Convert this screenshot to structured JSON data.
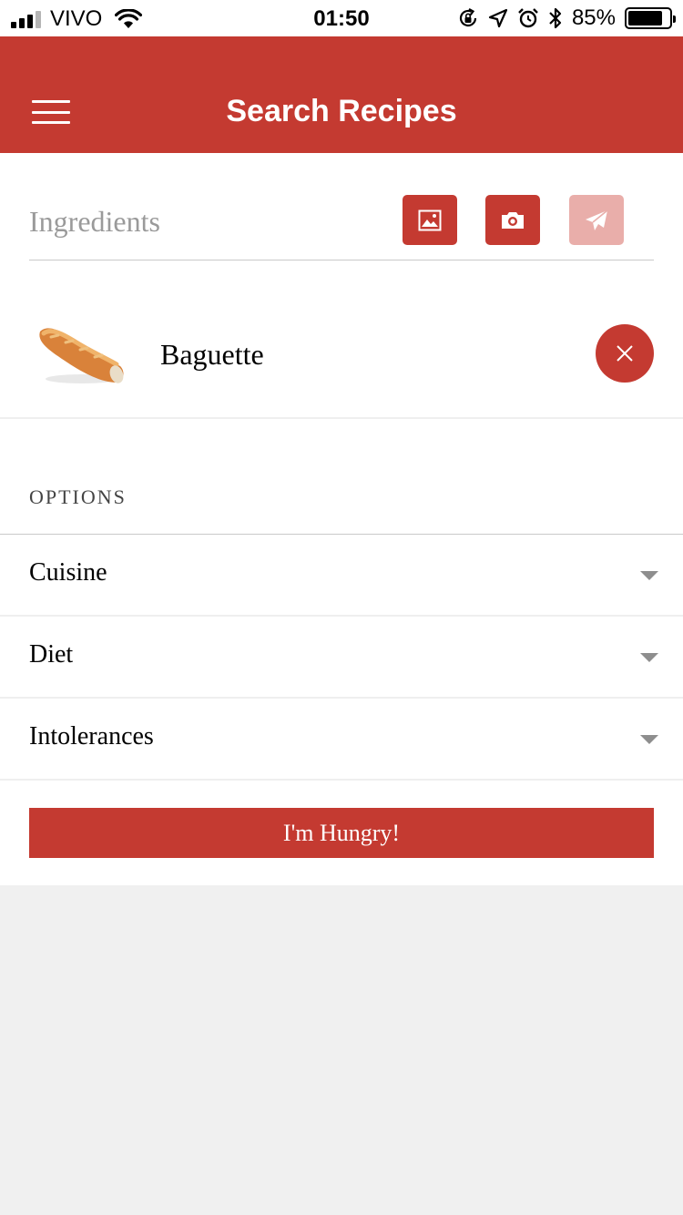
{
  "status_bar": {
    "carrier": "VIVO",
    "time": "01:50",
    "battery_percent": "85%",
    "battery_level": 0.85
  },
  "header": {
    "title": "Search Recipes",
    "background_color": "#c43a31",
    "menu_icon": "hamburger-menu-icon"
  },
  "ingredients": {
    "placeholder": "Ingredients",
    "value": "",
    "buttons": [
      {
        "icon": "image-gallery-icon",
        "enabled": true
      },
      {
        "icon": "camera-icon",
        "enabled": true
      },
      {
        "icon": "paper-plane-send-icon",
        "enabled": false
      }
    ]
  },
  "ingredient_list": [
    {
      "name": "Baguette",
      "thumbnail": "baguette-bread-image",
      "remove_icon": "close-icon"
    }
  ],
  "options": {
    "label": "OPTIONS",
    "items": [
      {
        "label": "Cuisine"
      },
      {
        "label": "Diet"
      },
      {
        "label": "Intolerances"
      }
    ]
  },
  "submit": {
    "label": "I'm Hungry!"
  },
  "colors": {
    "accent": "#c43a31",
    "accent_disabled": "#e9aeaa",
    "page_background": "#f0f0f0"
  }
}
